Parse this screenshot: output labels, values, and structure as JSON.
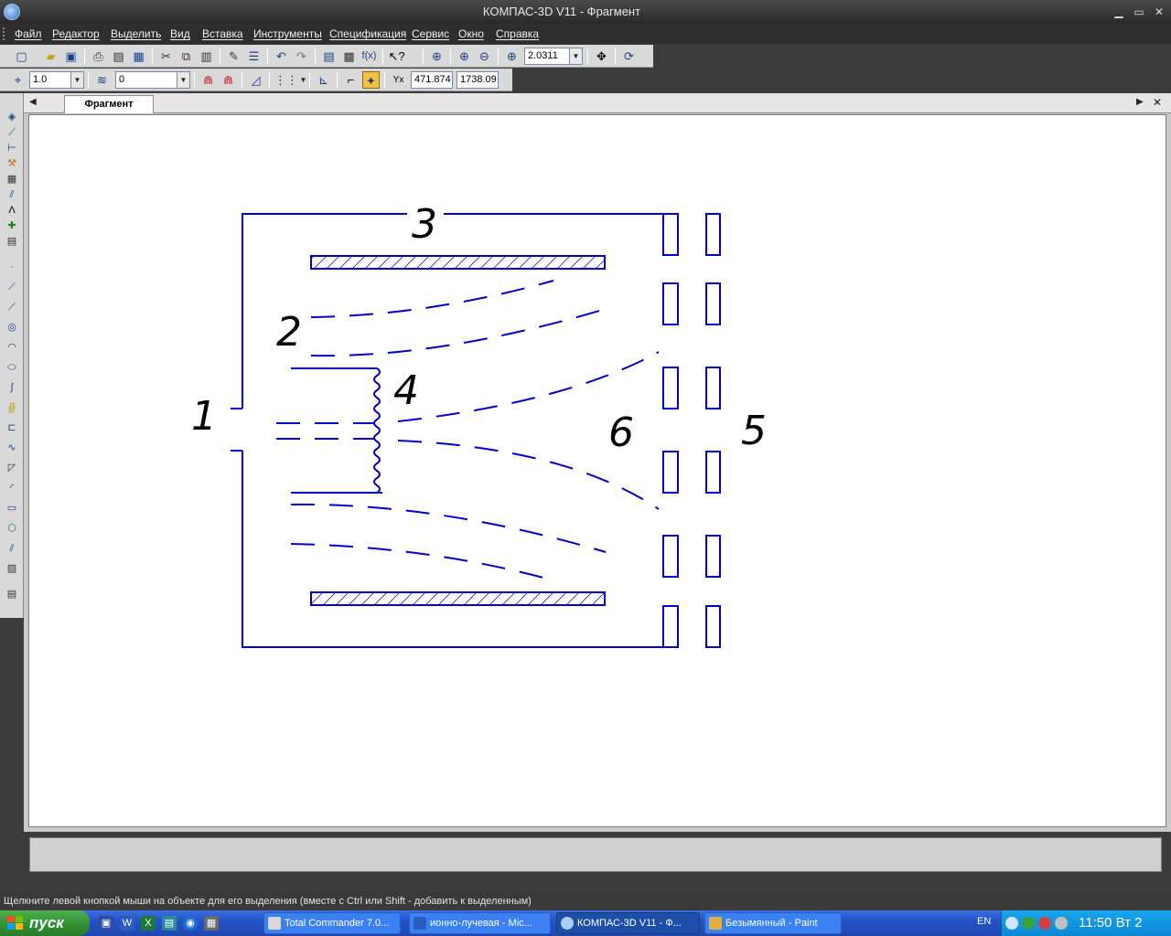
{
  "window": {
    "title": "КОМПАС-3D V11 - Фрагмент",
    "minimize": "▁",
    "restore": "▭",
    "close": "✕"
  },
  "menu": [
    "Файл",
    "Редактор",
    "Выделить",
    "Вид",
    "Вставка",
    "Инструменты",
    "Спецификация",
    "Сервис",
    "Окно",
    "Справка"
  ],
  "toolbar1": {
    "zoom_value": "2.0311"
  },
  "toolbar2": {
    "step_value": "1.0",
    "layer_value": "0",
    "coord_x": "471.874",
    "coord_y": "1738.09"
  },
  "document": {
    "tab_label": "Фрагмент"
  },
  "drawing": {
    "labels": [
      "1",
      "2",
      "3",
      "4",
      "5",
      "6"
    ],
    "line_color": "#0000cc"
  },
  "status": {
    "hint": "Щелкните левой кнопкой мыши на объекте для его выделения (вместе с Ctrl или Shift - добавить к выделенным)"
  },
  "taskbar": {
    "start_label": "пуск",
    "tasks": [
      "Total Commander 7.0...",
      "ионно-лучевая - Mic...",
      "КОМПАС-3D V11 - Ф...",
      "Безымянный - Paint"
    ],
    "language": "EN",
    "clock": "11:50 Вт 2"
  }
}
